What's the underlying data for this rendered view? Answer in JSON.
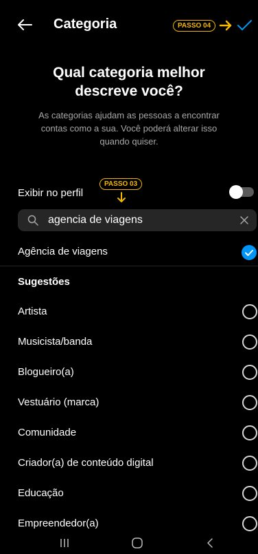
{
  "header": {
    "title": "Categoria",
    "step_badge": "PASSO 04"
  },
  "intro": {
    "headline": "Qual categoria melhor descreve você?",
    "description": "As categorias ajudam as pessoas a encontrar contas como a sua. Você poderá alterar isso quando quiser."
  },
  "profile_toggle": {
    "label": "Exibir no perfil",
    "step_badge": "PASSO 03",
    "enabled": false
  },
  "search": {
    "value": "agencia de viagens"
  },
  "selected": {
    "label": "Agência de viagens"
  },
  "suggestions": {
    "title": "Sugestões",
    "items": [
      "Artista",
      "Musicista/banda",
      "Blogueiro(a)",
      "Vestuário (marca)",
      "Comunidade",
      "Criador(a) de conteúdo digital",
      "Educação",
      "Empreendedor(a)"
    ]
  },
  "colors": {
    "background": "#000000",
    "accent": "#0095f6",
    "step_badge": "#f5b800"
  },
  "icons": [
    "back-arrow-icon",
    "check-icon",
    "search-icon",
    "close-icon",
    "arrow-down-icon",
    "arrow-right-icon",
    "recent-apps-icon",
    "home-icon",
    "nav-back-icon"
  ]
}
